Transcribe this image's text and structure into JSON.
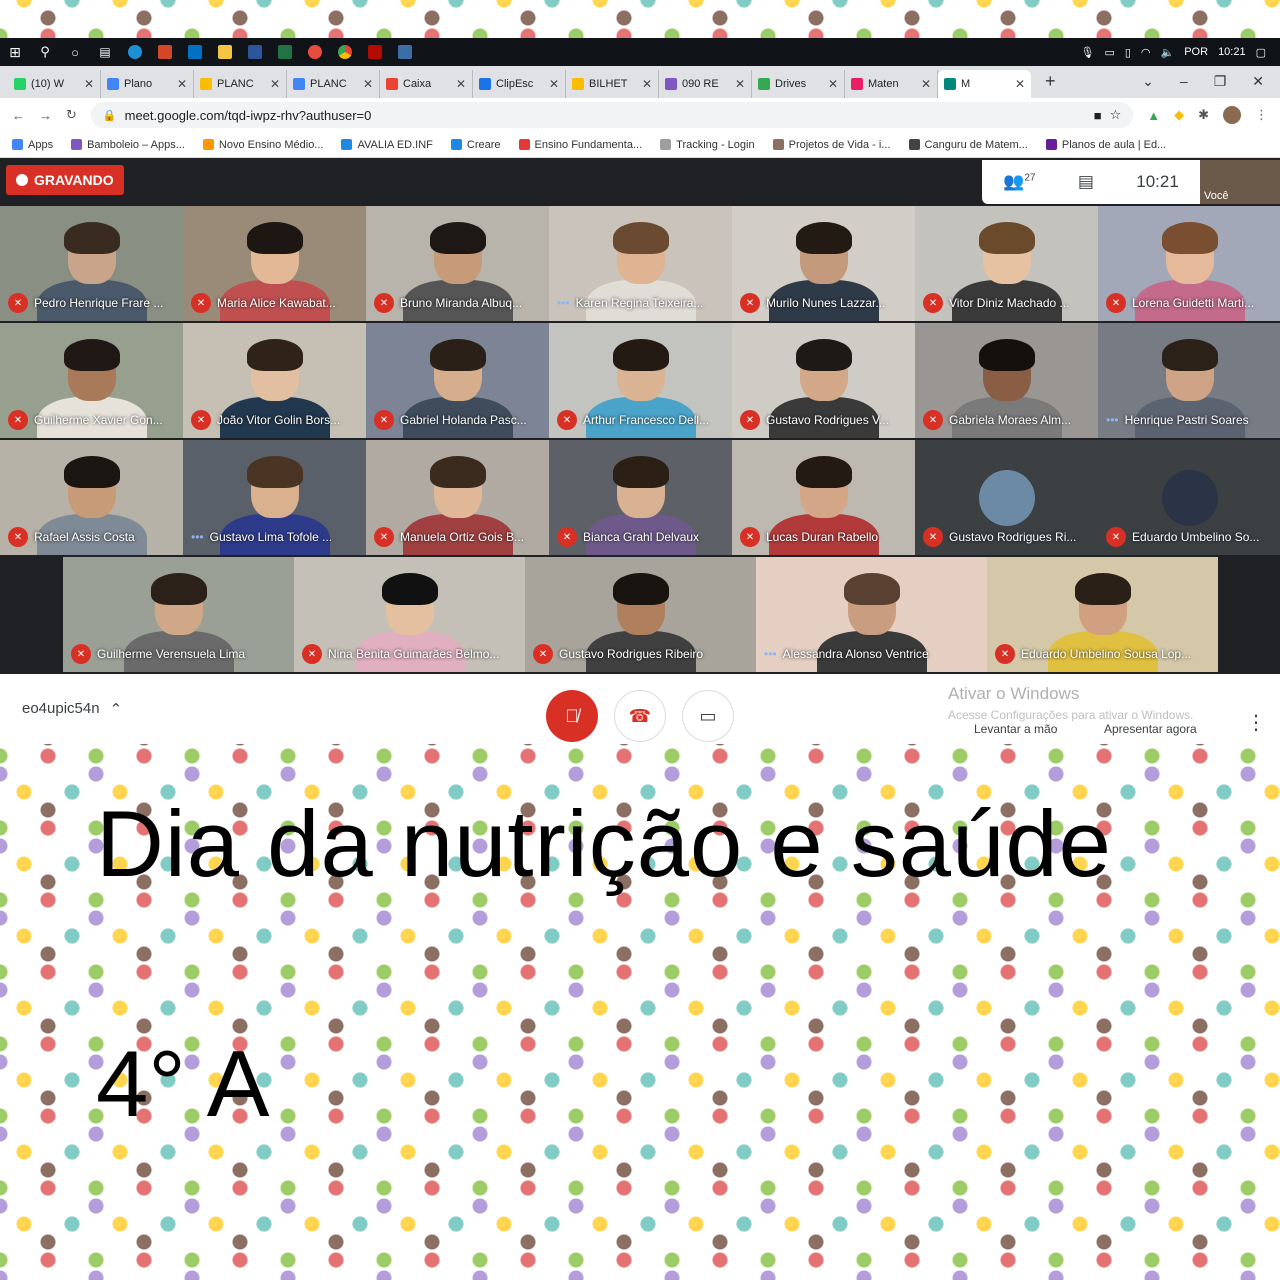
{
  "taskbar": {
    "tray_lang": "POR",
    "tray_time": "10:21"
  },
  "tabs": [
    {
      "label": "(10) W",
      "color": "#25d366"
    },
    {
      "label": "Plano",
      "color": "#4285f4"
    },
    {
      "label": "PLANC",
      "color": "#fbbc04"
    },
    {
      "label": "PLANC",
      "color": "#4285f4"
    },
    {
      "label": "Caixa",
      "color": "#ea4335"
    },
    {
      "label": "ClipEsc",
      "color": "#1a73e8"
    },
    {
      "label": "BILHET",
      "color": "#fbbc04"
    },
    {
      "label": "090 RE",
      "color": "#7e57c2"
    },
    {
      "label": "Drives",
      "color": "#34a853"
    },
    {
      "label": "Maten",
      "color": "#e91e63"
    },
    {
      "label": "M",
      "color": "#00897b"
    }
  ],
  "address": {
    "url": "meet.google.com/tqd-iwpz-rhv?authuser=0"
  },
  "bookmarks": [
    {
      "label": "Apps",
      "color": "#4285f4"
    },
    {
      "label": "Bamboleio – Apps...",
      "color": "#7e57c2"
    },
    {
      "label": "Novo Ensino Médio...",
      "color": "#ff9800"
    },
    {
      "label": "AVALIA ED.INF",
      "color": "#1e88e5"
    },
    {
      "label": "Creare",
      "color": "#1e88e5"
    },
    {
      "label": "Ensino Fundamenta...",
      "color": "#e53935"
    },
    {
      "label": "Tracking - Login",
      "color": "#9e9e9e"
    },
    {
      "label": "Projetos de Vida - i...",
      "color": "#8d6e63"
    },
    {
      "label": "Canguru de Matem...",
      "color": "#424242"
    },
    {
      "label": "Planos de aula | Ed...",
      "color": "#6a1b9a"
    }
  ],
  "meet": {
    "recording_label": "GRAVANDO",
    "people_count": "27",
    "clock": "10:21",
    "self_label": "Você",
    "meeting_code": "eo4upic54n",
    "activate_title": "Ativar o Windows",
    "activate_sub": "Acesse Configurações para ativar o Windows.",
    "raise_hand": "Levantar a mão",
    "present_now": "Apresentar agora"
  },
  "participants_row1": [
    {
      "name": "Pedro Henrique Frare ...",
      "bg": "#8a8f84",
      "skin": "#c9a48a",
      "hair": "#3a2b20",
      "shirt": "#4a5a6a",
      "talk": false
    },
    {
      "name": "Maria Alice Kawabat...",
      "bg": "#9a8a78",
      "skin": "#e2b896",
      "hair": "#1d1612",
      "shirt": "#c05050",
      "talk": false
    },
    {
      "name": "Bruno Miranda Albuq...",
      "bg": "#b8b4ac",
      "skin": "#c79a7a",
      "hair": "#1e1814",
      "shirt": "#555555",
      "talk": false
    },
    {
      "name": "Karen Regina Teixeira...",
      "bg": "#c9c3bb",
      "skin": "#e0b493",
      "hair": "#6b4a32",
      "shirt": "#e0ddd6",
      "talk": true
    },
    {
      "name": "Murilo Nunes Lazzar...",
      "bg": "#d2cec7",
      "skin": "#c49a7c",
      "hair": "#231a14",
      "shirt": "#2f3a48",
      "talk": false
    },
    {
      "name": "Vitor Diniz Machado ...",
      "bg": "#c4c2bd",
      "skin": "#e6c2a2",
      "hair": "#6b4a2c",
      "shirt": "#3a3a3a",
      "talk": false
    },
    {
      "name": "Lorena Guidetti Marti...",
      "bg": "#a2a8b8",
      "skin": "#e5b99a",
      "hair": "#7a4e30",
      "shirt": "#c46a8a",
      "talk": false
    }
  ],
  "participants_row2": [
    {
      "name": "Guilherme Xavier Gon...",
      "bg": "#97a08f",
      "skin": "#a87a5a",
      "hair": "#201814",
      "shirt": "#e6e2da",
      "talk": false
    },
    {
      "name": "João Vitor Golin Bors...",
      "bg": "#c6bfb4",
      "skin": "#e2bfa0",
      "hair": "#2e2219",
      "shirt": "#22384e",
      "talk": false
    },
    {
      "name": "Gabriel Holanda Pasc...",
      "bg": "#7d8496",
      "skin": "#d6ad8d",
      "hair": "#2a2018",
      "shirt": "#3f4c5c",
      "talk": false
    },
    {
      "name": "Arthur Francesco Dell...",
      "bg": "#c3c4c0",
      "skin": "#dab393",
      "hair": "#241a14",
      "shirt": "#4aa3c9",
      "talk": false
    },
    {
      "name": "Gustavo Rodrigues V...",
      "bg": "#cfccc6",
      "skin": "#d3a888",
      "hair": "#1f1915",
      "shirt": "#3a3a3a",
      "talk": false
    },
    {
      "name": "Gabriela Moraes Alm...",
      "bg": "#9a9694",
      "skin": "#8a5e45",
      "hair": "#15100d",
      "shirt": "#7a7a7a",
      "talk": false
    },
    {
      "name": "Henrique Pastri Soares",
      "bg": "#767b84",
      "skin": "#cfa486",
      "hair": "#2b2119",
      "shirt": "#5b6270",
      "talk": true
    }
  ],
  "participants_row3": [
    {
      "name": "Rafael Assis Costa",
      "bg": "#b6b2a8",
      "skin": "#c79a78",
      "hair": "#1c1612",
      "shirt": "#7e8a96",
      "talk": false
    },
    {
      "name": "Gustavo Lima Tofole ...",
      "bg": "#59606a",
      "skin": "#d9b18f",
      "hair": "#4a3524",
      "shirt": "#2e3b8a",
      "talk": true
    },
    {
      "name": "Manuela Ortiz Gois B...",
      "bg": "#b0aaa2",
      "skin": "#e0b898",
      "hair": "#3b2a1e",
      "shirt": "#a04040",
      "talk": false
    },
    {
      "name": "Bianca Grahl Delvaux",
      "bg": "#5e6068",
      "skin": "#d8b092",
      "hair": "#2b1f16",
      "shirt": "#6e5a8a",
      "talk": false
    },
    {
      "name": "Lucas Duran Rabello",
      "bg": "#bdb8b0",
      "skin": "#d2a686",
      "hair": "#231a14",
      "shirt": "#b23a3a",
      "talk": false
    },
    {
      "name": "Gustavo Rodrigues Ri...",
      "bg": "#3c4043",
      "avatar": "#6c8aa6",
      "talk": false
    },
    {
      "name": "Eduardo Umbelino So...",
      "bg": "#3c4043",
      "avatar": "#2a3446",
      "talk": false
    }
  ],
  "participants_row4": [
    {
      "name": "Guilherme Verensuela Lima",
      "bg": "#9aa096",
      "skin": "#d0a888",
      "hair": "#2c2118",
      "shirt": "#6a6a6a",
      "talk": false
    },
    {
      "name": "Nina Benita Guimarães Belmo...",
      "bg": "#c4c0b8",
      "skin": "#e4c0a0",
      "hair": "#111111",
      "shirt": "#e0b0c0",
      "talk": false
    },
    {
      "name": "Gustavo Rodrigues Ribeiro",
      "bg": "#a8a49c",
      "skin": "#b0805e",
      "hair": "#1a1410",
      "shirt": "#404040",
      "talk": false
    },
    {
      "name": "Alessandra Alonso Ventrice",
      "bg": "#e4cfc2",
      "skin": "#c99d80",
      "hair": "#5a4030",
      "shirt": "#3a3a3a",
      "talk": true
    },
    {
      "name": "Eduardo Umbelino Sousa Lop...",
      "bg": "#d4c8a8",
      "skin": "#d0a080",
      "hair": "#2a2018",
      "shirt": "#e0c040",
      "talk": false
    }
  ],
  "caption": {
    "title": "Dia da nutrição e saúde",
    "class_label": "4° A"
  },
  "icons": {
    "mic_off": "mic-off-icon",
    "hangup": "phone-hangup-icon",
    "camera": "camera-icon"
  }
}
